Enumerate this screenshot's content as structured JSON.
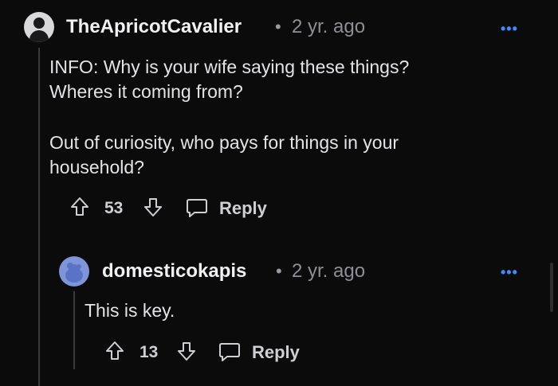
{
  "comment": {
    "username": "TheApricotCavalier",
    "separator": "•",
    "time": "2 yr. ago",
    "more_label": "•••",
    "paragraphs": [
      "INFO: Why is your wife saying these things?\nWheres it coming from?",
      "Out of curiosity, who pays for things in your\nhousehold?"
    ],
    "upvotes": "53",
    "reply_label": "Reply"
  },
  "reply": {
    "username": "domesticokapis",
    "separator": "•",
    "time": "2 yr. ago",
    "more_label": "•••",
    "body": "This is key.",
    "upvotes": "13",
    "reply_label": "Reply"
  },
  "icons": {
    "upvote": "arrow-up-icon",
    "downvote": "arrow-down-icon",
    "reply": "speech-bubble-icon",
    "more": "more-options-icon"
  },
  "colors": {
    "background": "#0b0b0c",
    "accent": "#3d8bff",
    "reply_avatar": "#7f95d9"
  }
}
